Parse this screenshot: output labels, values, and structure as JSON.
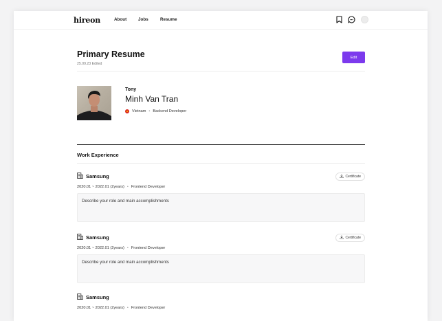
{
  "nav": {
    "logo": "hireon",
    "links": [
      "About",
      "Jobs",
      "Resume"
    ]
  },
  "resume": {
    "title": "Primary Resume",
    "edited": "25.09.23 Edited",
    "edit_label": "Edit"
  },
  "profile": {
    "nickname": "Tony",
    "full_name": "Minh Van Tran",
    "country": "Vietnam",
    "role": "Backend Developer"
  },
  "section": {
    "title": "Work Experience"
  },
  "experiences": [
    {
      "company": "Samsung",
      "period": "2020.01 ~ 2022.01 (2years)",
      "position": "Frontend Developer",
      "certificate_label": "Certificate",
      "description": "Describe your role and main accomplishments"
    },
    {
      "company": "Samsung",
      "period": "2020.01 ~ 2022.01 (2years)",
      "position": "Frontend Developer",
      "certificate_label": "Certificate",
      "description": "Describe your role and main accomplishments"
    },
    {
      "company": "Samsung",
      "period": "2020.01 ~ 2022.01 (2years)",
      "position": "Frontend Developer"
    }
  ],
  "colors": {
    "accent": "#7c3aed",
    "flag": "#da251d"
  }
}
